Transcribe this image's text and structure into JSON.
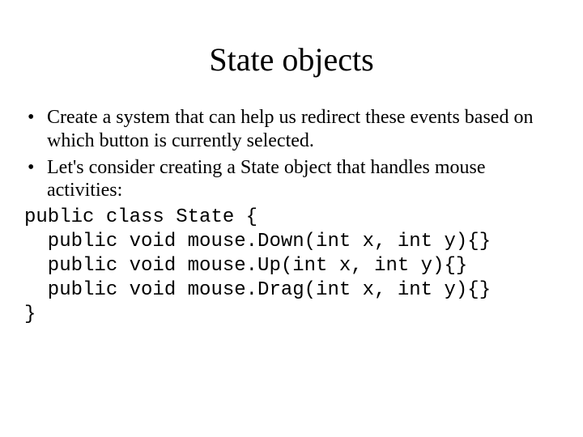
{
  "title": "State objects",
  "bullets": [
    "Create a system that can help us redirect these events based on which button is currently selected.",
    "Let's consider creating a State object that handles mouse activities:"
  ],
  "code_lines": [
    "public class State {",
    "  public void mouse.Down(int x, int y){}",
    "  public void mouse.Up(int x, int y){}",
    "  public void mouse.Drag(int x, int y){}",
    "}"
  ]
}
